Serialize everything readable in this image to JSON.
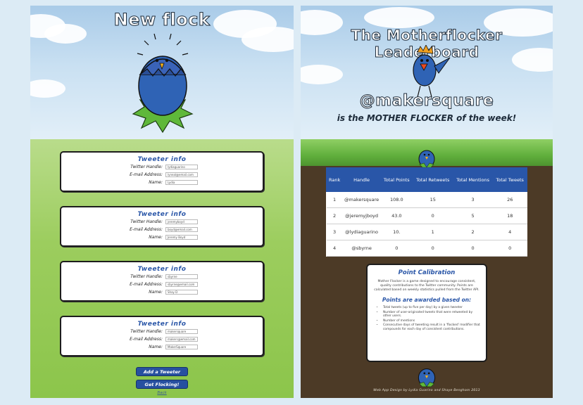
{
  "left": {
    "title": "New flock",
    "card_title": "Tweeter info",
    "labels": {
      "handle": "Twitter Handle:",
      "email": "E-mail Address:",
      "name": "Name:"
    },
    "tweeters": [
      {
        "handle": "lydiaguarino",
        "email": "lyneal@email.com",
        "name": "Lydia"
      },
      {
        "handle": "jeremyboyd",
        "email": "boyd@email.com",
        "name": "Jeremy Boyd"
      },
      {
        "handle": "sbyrne",
        "email": "sbyrne@email.com",
        "name": "Shay D"
      },
      {
        "handle": "makersquare",
        "email": "makers@email.com",
        "name": "MakerSquare"
      }
    ],
    "add_button": "Add a Tweeter",
    "submit_button": "Get Flocking!",
    "back_link": "Back"
  },
  "right": {
    "title": "The Motherflocker Leaderboard",
    "winner_handle": "@makersquare",
    "winner_line": "is the MOTHER FLOCKER of the week!",
    "columns": [
      "Rank",
      "Handle",
      "Total Points",
      "Total Retweets",
      "Total Mentions",
      "Total Tweets"
    ],
    "rows": [
      [
        "1",
        "@makersquare",
        "108.0",
        "15",
        "3",
        "26"
      ],
      [
        "2",
        "@jeremyjboyd",
        "43.0",
        "0",
        "5",
        "18"
      ],
      [
        "3",
        "@lydiaguarino",
        "10.",
        "1",
        "2",
        "4"
      ],
      [
        "4",
        "@sbyrne",
        "0",
        "0",
        "0",
        "0"
      ]
    ],
    "calibration_title": "Point Calibration",
    "calibration_desc": "Mother Flocker is a game designed to encourage consistent, quality contributions to the Twitter community. Points are calculated based on weekly statistics pulled from the Twitter API.",
    "awarded_title": "Points are awarded based on:",
    "rules": [
      "Total tweets (up to five per day) by a given tweeter",
      "Number of user-originated tweets that were retweeted by other users.",
      "Number of mentions",
      "Consecutive days of tweeting result in a 'flocked' modifier that compounds for each day of consistent contributions."
    ],
    "footer": "Web App Design by Lydia Guarino and Shaye Bengham 2013"
  },
  "colors": {
    "accent": "#2956a8",
    "bird_blue": "#3a63b8",
    "grass": "#8cc54b",
    "dirt": "#4c3a26"
  }
}
